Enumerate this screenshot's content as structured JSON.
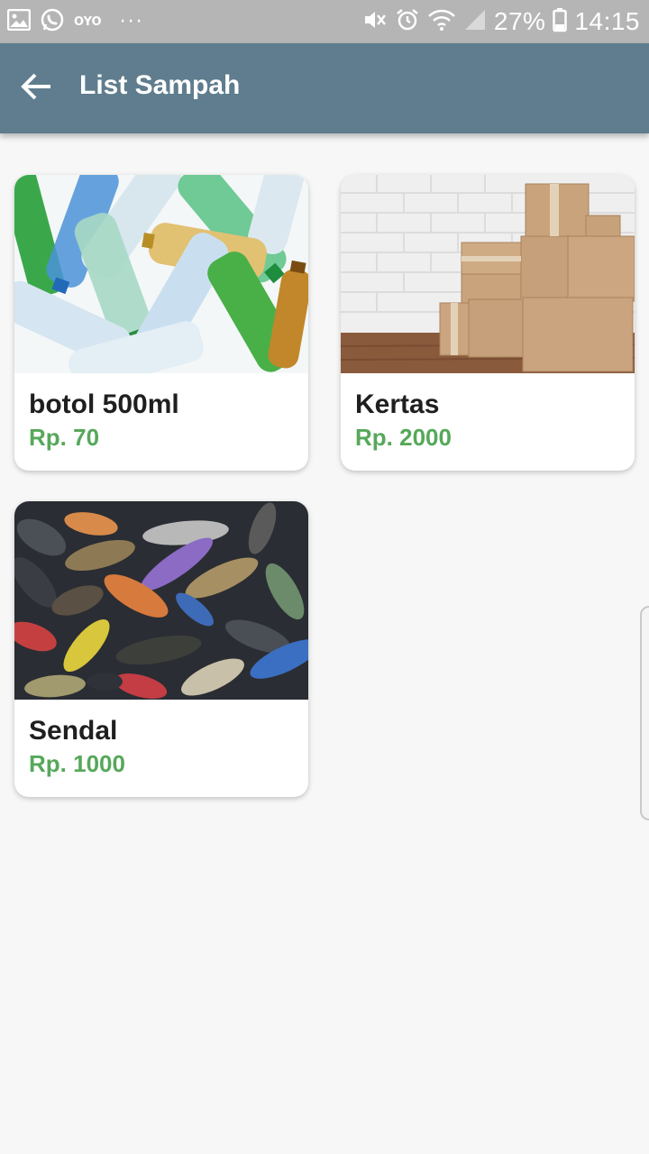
{
  "status_bar": {
    "carrier_label": "OYO",
    "more_indicator": "···",
    "battery_percent": "27%",
    "time": "14:15",
    "icons": [
      "gallery-icon",
      "whatsapp-icon",
      "mute-icon",
      "alarm-icon",
      "wifi-icon",
      "signal-icon",
      "battery-icon"
    ]
  },
  "app_bar": {
    "title": "List Sampah",
    "back_icon": "arrow-left-icon",
    "background_color": "#5f7d8e"
  },
  "items": [
    {
      "name": "botol 500ml",
      "price": "Rp. 70",
      "image": "plastic-bottles-image"
    },
    {
      "name": "Kertas",
      "price": "Rp. 2000",
      "image": "cardboard-boxes-image"
    },
    {
      "name": "Sendal",
      "price": "Rp. 1000",
      "image": "sandals-pile-image"
    }
  ],
  "colors": {
    "price": "#56a85a",
    "name": "#1f1f1f",
    "background": "#f7f7f7"
  }
}
